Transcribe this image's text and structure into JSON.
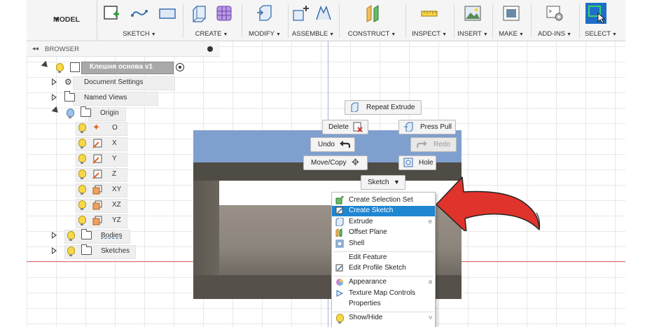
{
  "toolbar": {
    "workspace": "MODEL",
    "groups": [
      {
        "label": "SKETCH"
      },
      {
        "label": "CREATE"
      },
      {
        "label": "MODIFY"
      },
      {
        "label": "ASSEMBLE"
      },
      {
        "label": "CONSTRUCT"
      },
      {
        "label": "INSPECT"
      },
      {
        "label": "INSERT"
      },
      {
        "label": "MAKE"
      },
      {
        "label": "ADD-INS"
      },
      {
        "label": "SELECT"
      }
    ]
  },
  "browser": {
    "title": "BROWSER",
    "root": "Клешня основа v1",
    "items": [
      {
        "label": "Document Settings"
      },
      {
        "label": "Named Views"
      },
      {
        "label": "Origin"
      },
      {
        "label": "O"
      },
      {
        "label": "X"
      },
      {
        "label": "Y"
      },
      {
        "label": "Z"
      },
      {
        "label": "XY"
      },
      {
        "label": "XZ"
      },
      {
        "label": "YZ"
      },
      {
        "label": "Bodies"
      },
      {
        "label": "Sketches"
      }
    ]
  },
  "marking_menu": {
    "repeat": "Repeat Extrude",
    "delete": "Delete",
    "press_pull": "Press Pull",
    "undo": "Undo",
    "redo": "Redo",
    "move_copy": "Move/Copy",
    "hole": "Hole",
    "sketch": "Sketch"
  },
  "context_menu": {
    "items": [
      {
        "label": "Create Selection Set",
        "shortcut": ""
      },
      {
        "label": "Create Sketch",
        "shortcut": "",
        "selected": true
      },
      {
        "label": "Extrude",
        "shortcut": "e"
      },
      {
        "label": "Offset Plane",
        "shortcut": ""
      },
      {
        "label": "Shell",
        "shortcut": ""
      },
      {
        "label": "Edit Feature",
        "shortcut": ""
      },
      {
        "label": "Edit Profile Sketch",
        "shortcut": ""
      },
      {
        "label": "Appearance",
        "shortcut": "a"
      },
      {
        "label": "Texture Map Controls",
        "shortcut": ""
      },
      {
        "label": "Properties",
        "shortcut": ""
      },
      {
        "label": "Show/Hide",
        "shortcut": "v"
      }
    ]
  },
  "colors": {
    "accent": "#1f86d1",
    "arrow": "#e0332b",
    "select_active": "#1aa04a"
  }
}
